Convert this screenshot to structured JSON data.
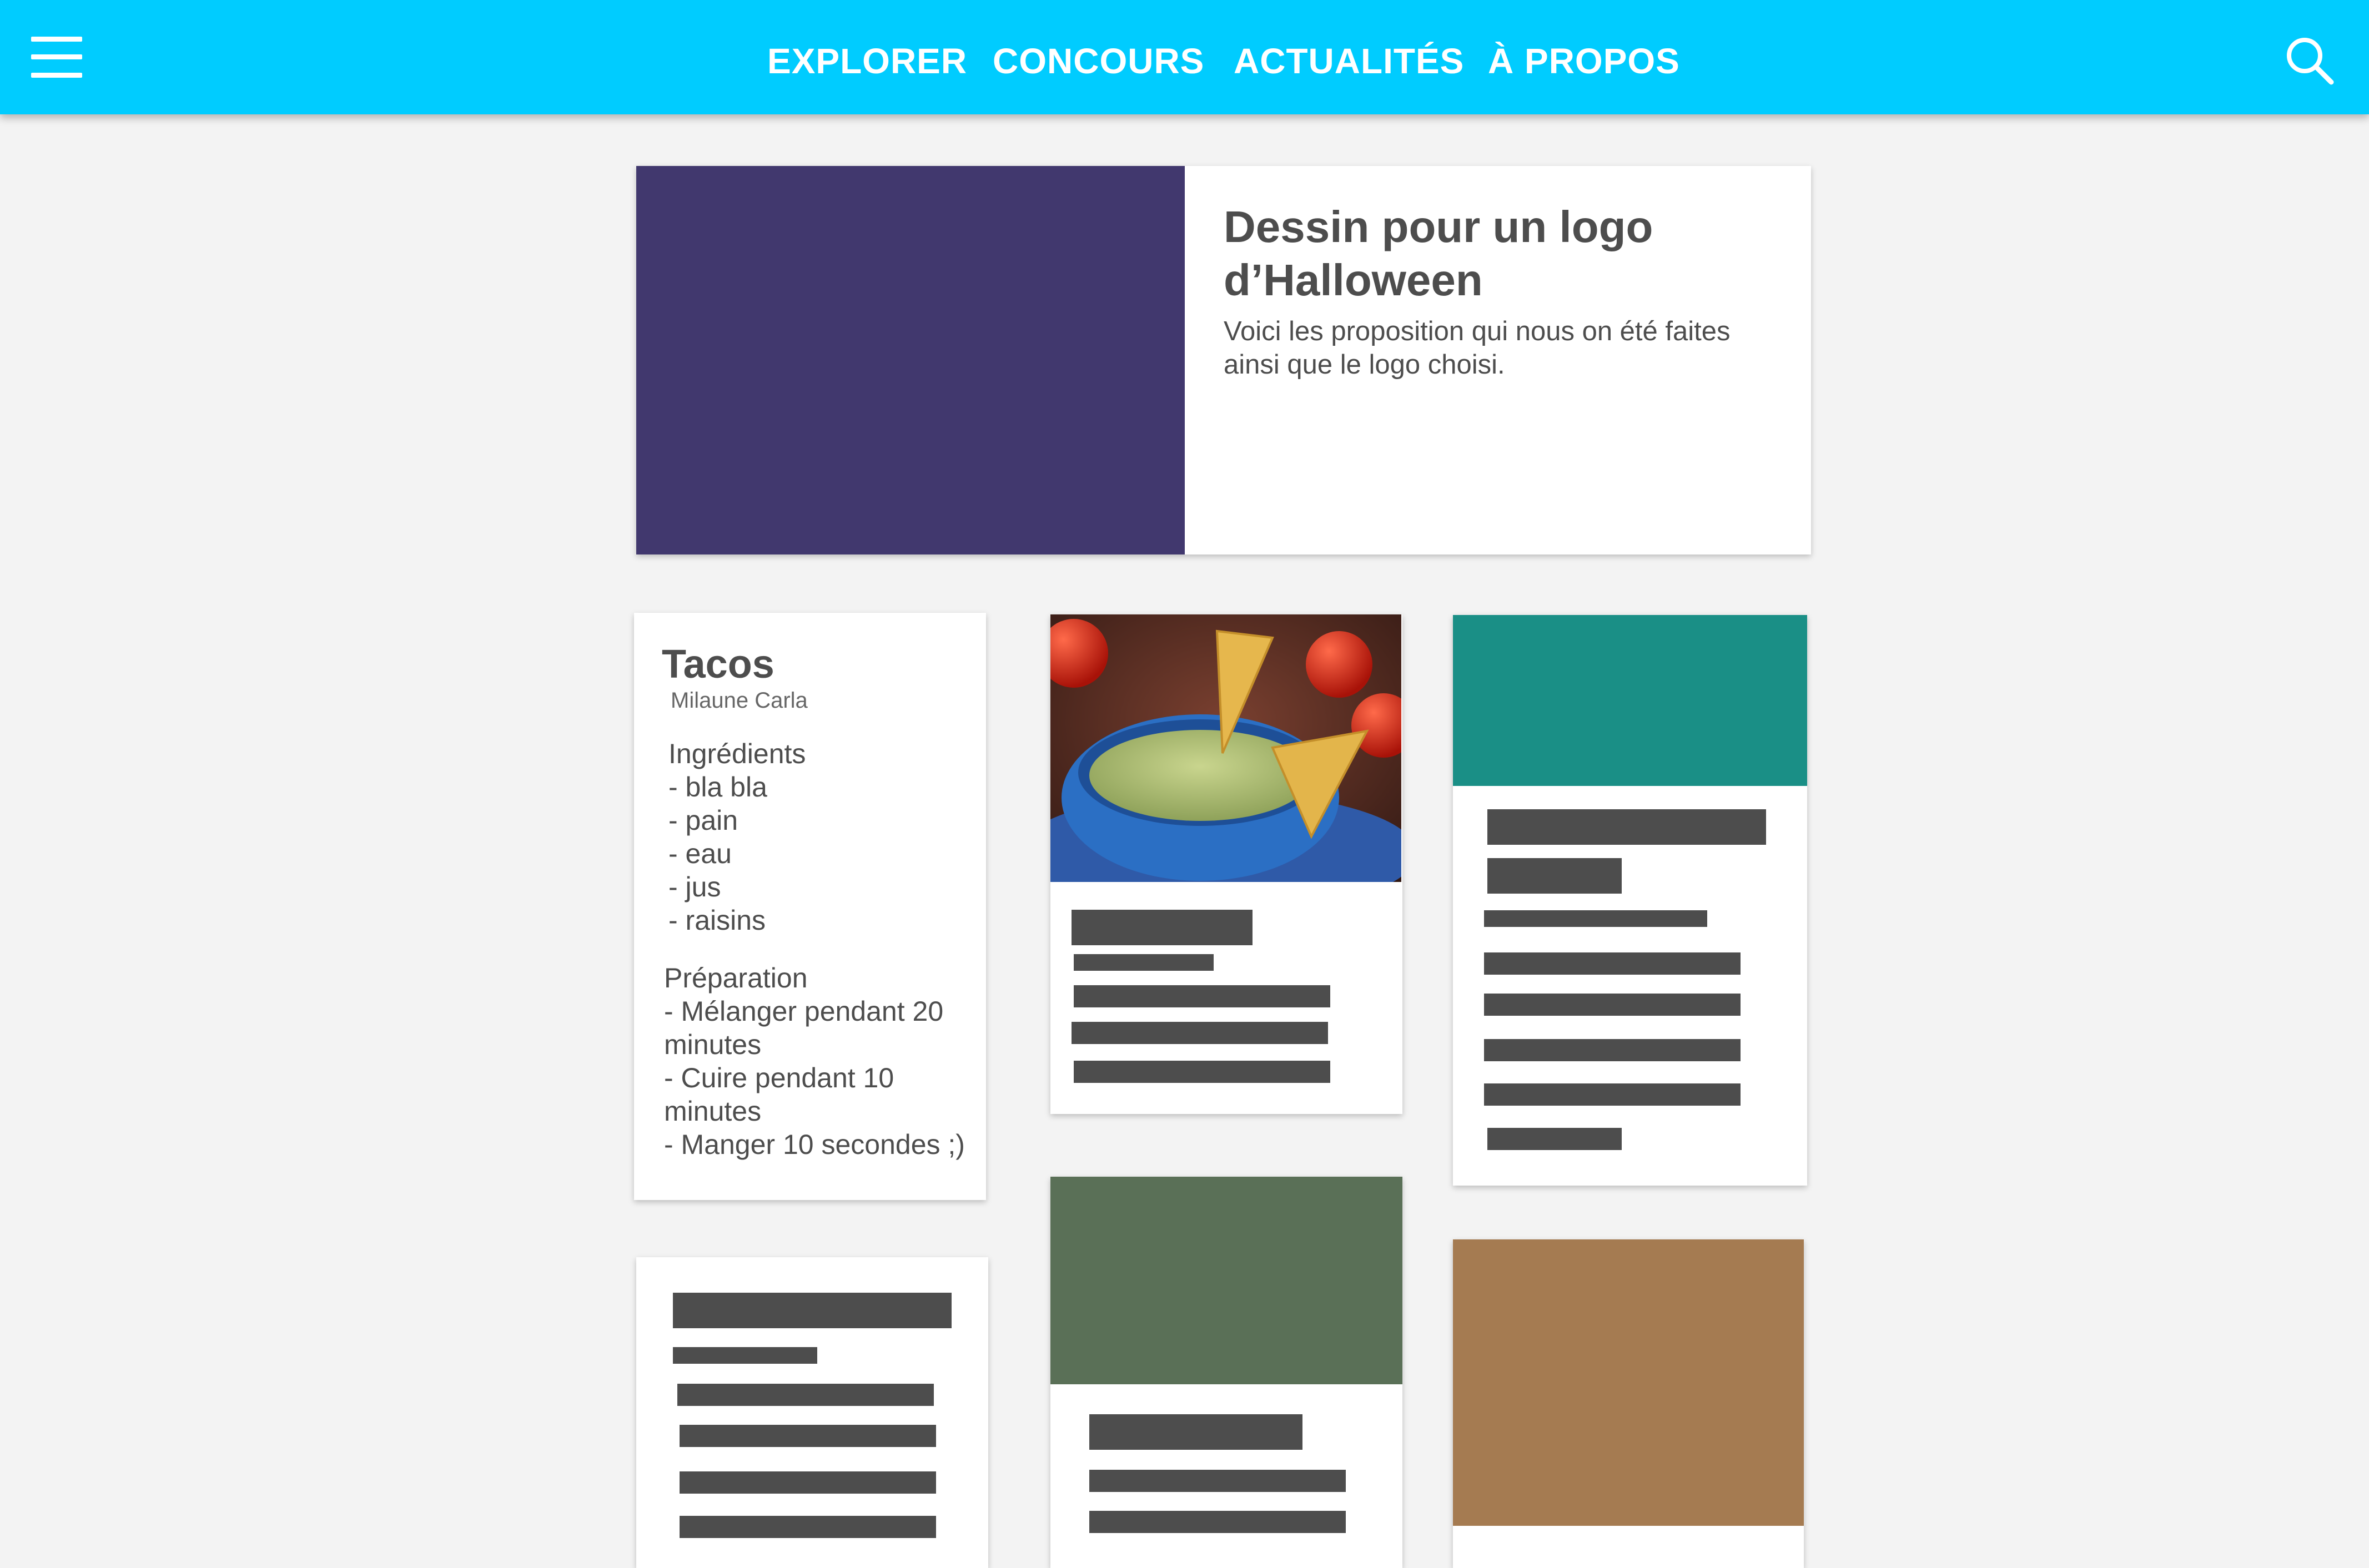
{
  "nav": {
    "menu_icon": "hamburger-menu-icon",
    "items": [
      "EXPLORER",
      "CONCOURS",
      "ACTUALITÉS",
      "À PROPOS"
    ],
    "search_icon": "search-icon"
  },
  "featured": {
    "title": "Dessin pour un logo d’Halloween",
    "description": "Voici les proposition qui nous on été faites ainsi que le logo choisi.",
    "image_color": "#41386e"
  },
  "recipe": {
    "title": "Tacos",
    "author": "Milaune Carla",
    "ingredients_heading": "Ingrédients",
    "ingredients": [
      "- bla bla",
      "- pain",
      "- eau",
      "- jus",
      "- raisins"
    ],
    "preparation_heading": "Préparation",
    "preparation_lines": [
      "- Mélanger pendant 20",
      "minutes",
      "- Cuire pendant 10",
      "minutes",
      "- Manger 10 secondes ;)"
    ]
  },
  "cards": {
    "guacamole_image": "guacamole-photo",
    "teal_color": "#1a8f86",
    "green_color": "#5a7057",
    "brown_color": "#a57b51"
  },
  "colors": {
    "header": "#00ccff",
    "background": "#f3f3f3",
    "text": "#4d4d4d",
    "placeholder": "#4d4d4d"
  }
}
